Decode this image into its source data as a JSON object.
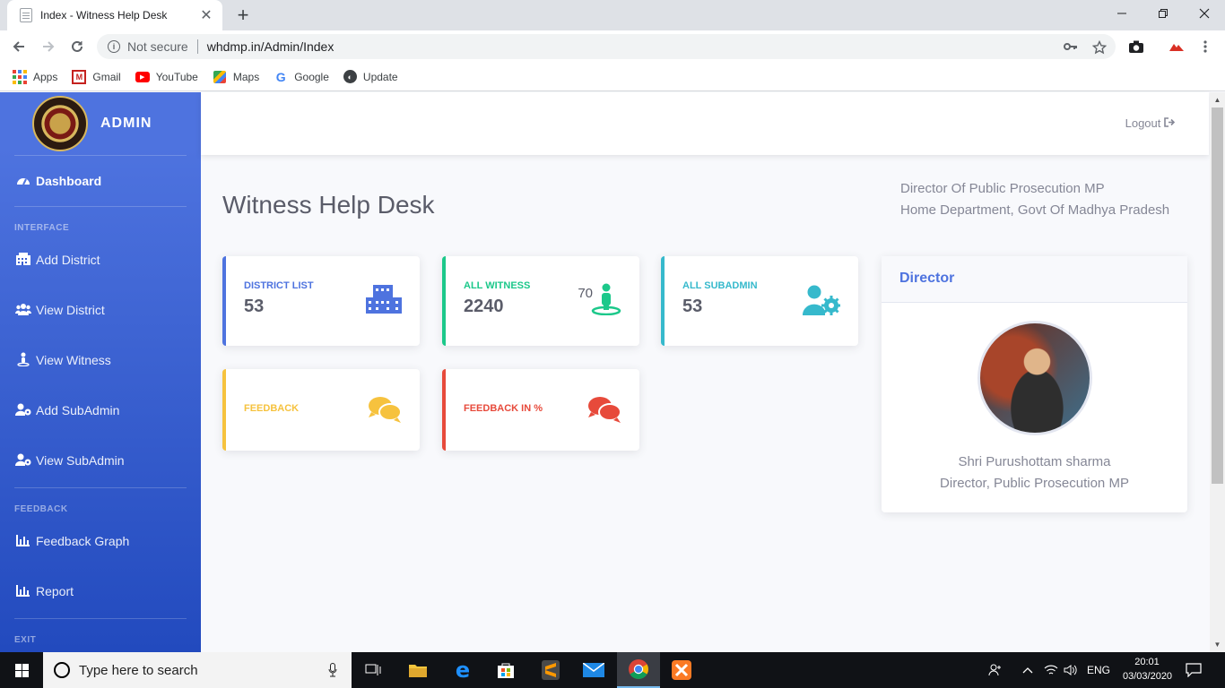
{
  "browser": {
    "tab_title": "Index - Witness Help Desk",
    "tab_close": "✕",
    "new_tab": "+",
    "security_label": "Not secure",
    "url": "whdmp.in/Admin/Index",
    "bookmarks": [
      {
        "label": "Apps",
        "icon": "apps-grid-icon"
      },
      {
        "label": "Gmail",
        "icon": "gmail-icon"
      },
      {
        "label": "YouTube",
        "icon": "youtube-icon"
      },
      {
        "label": "Maps",
        "icon": "maps-icon"
      },
      {
        "label": "Google",
        "icon": "google-icon"
      },
      {
        "label": "Update",
        "icon": "update-icon"
      }
    ]
  },
  "sidebar": {
    "brand": "ADMIN",
    "dashboard": "Dashboard",
    "heading_interface": "INTERFACE",
    "items_interface": [
      {
        "label": "Add District",
        "icon": "building-icon"
      },
      {
        "label": "View District",
        "icon": "users-icon"
      },
      {
        "label": "View Witness",
        "icon": "person-icon"
      },
      {
        "label": "Add SubAdmin",
        "icon": "user-cog-icon"
      },
      {
        "label": "View SubAdmin",
        "icon": "user-cog-icon"
      }
    ],
    "heading_feedback": "FEEDBACK",
    "items_feedback": [
      {
        "label": "Feedback Graph",
        "icon": "chart-bar-icon"
      },
      {
        "label": "Report",
        "icon": "chart-bar-icon"
      }
    ],
    "heading_exit": "EXIT"
  },
  "topbar": {
    "logout": "Logout"
  },
  "main": {
    "title": "Witness Help Desk",
    "dept_line1": "Director Of Public Prosecution MP",
    "dept_line2": "Home Department, Govt Of Madhya Pradesh",
    "cards": [
      {
        "label": "DISTRICT LIST",
        "value": "53",
        "color": "#4e73df",
        "icon": "city-icon"
      },
      {
        "label": "ALL WITNESS",
        "value": "2240",
        "extra": "70",
        "color": "#1cc88a",
        "icon": "street-view-icon"
      },
      {
        "label": "ALL SUBADMIN",
        "value": "53",
        "color": "#36b9cc",
        "icon": "user-cog-icon"
      },
      {
        "label": "FEEDBACK",
        "value": "",
        "color": "#f6c23e",
        "icon": "comments-icon"
      },
      {
        "label": "FEEDBACK IN %",
        "value": "",
        "color": "#e74a3b",
        "icon": "comments-icon"
      }
    ],
    "director": {
      "header": "Director",
      "name": "Shri Purushottam sharma",
      "designation": "Director, Public Prosecution MP"
    }
  },
  "taskbar": {
    "search_placeholder": "Type here to search",
    "language": "ENG",
    "time": "20:01",
    "date": "03/03/2020"
  }
}
